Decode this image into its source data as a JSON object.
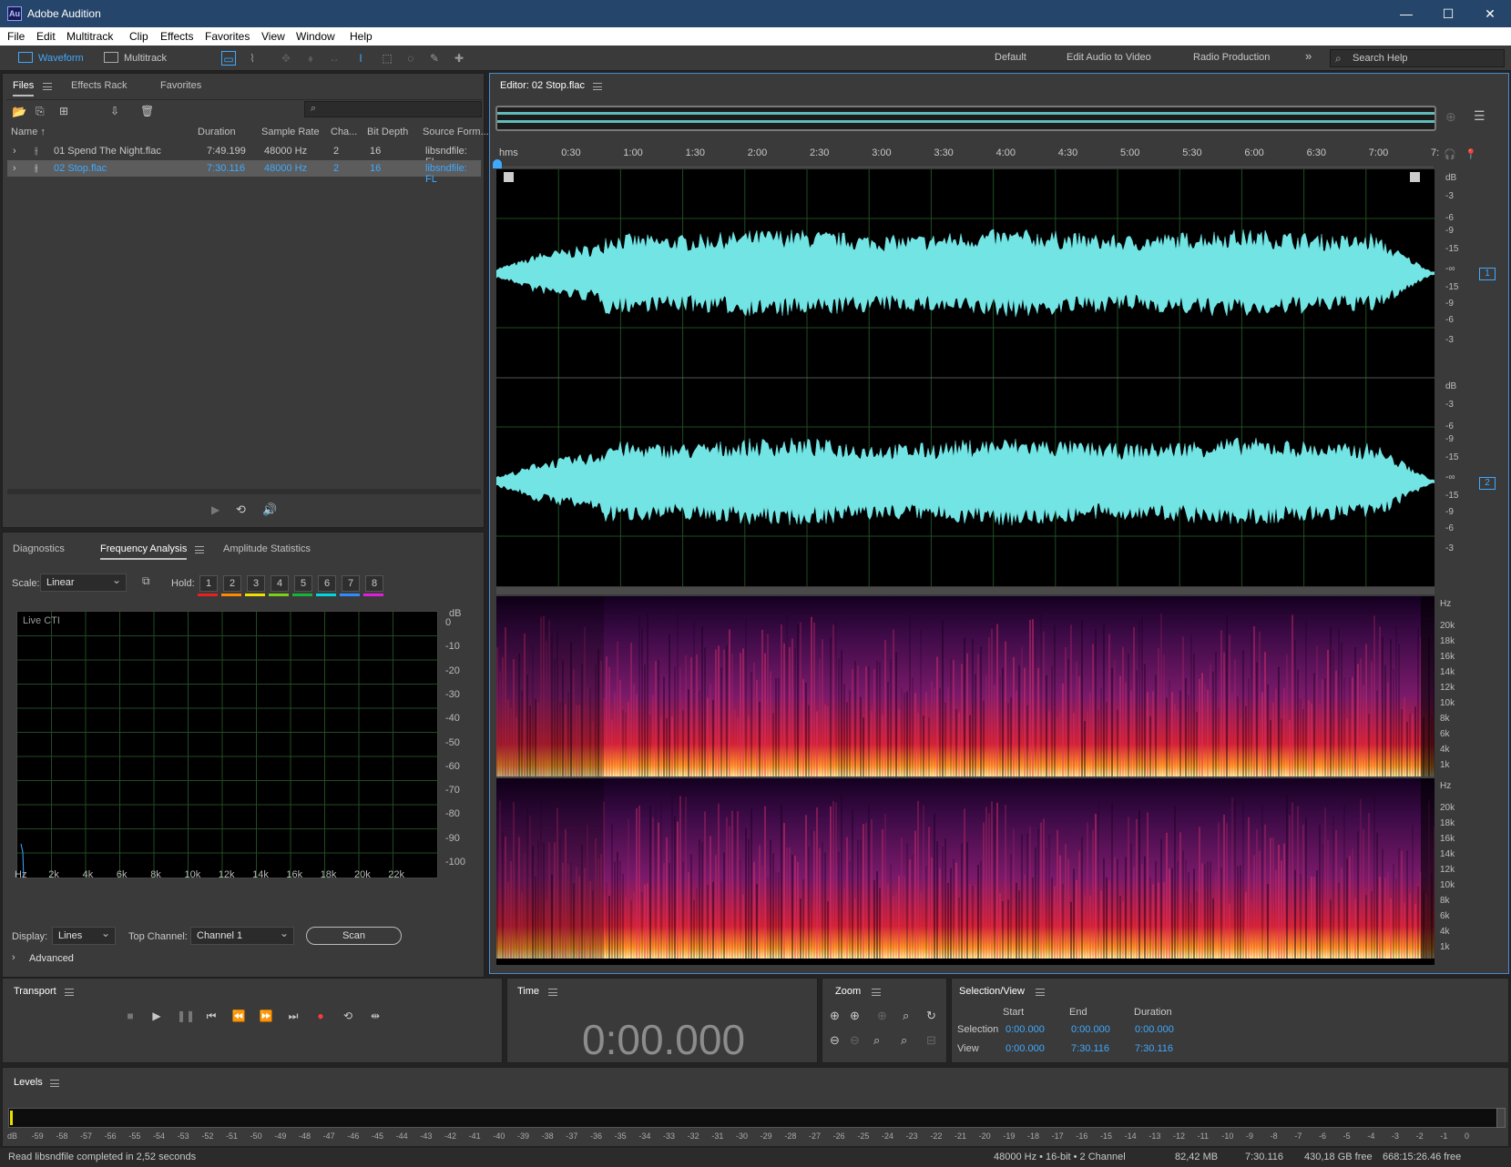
{
  "window": {
    "title": "Adobe Audition",
    "app_icon_text": "Au"
  },
  "menu": [
    "File",
    "Edit",
    "Multitrack",
    "Clip",
    "Effects",
    "Favorites",
    "View",
    "Window",
    "Help"
  ],
  "toolbar": {
    "waveform_label": "Waveform",
    "multitrack_label": "Multitrack",
    "workspaces": [
      "Default",
      "Edit Audio to Video",
      "Radio Production"
    ],
    "overflow": "»",
    "search_placeholder": "Search Help"
  },
  "files_panel": {
    "tabs": [
      "Files",
      "Effects Rack",
      "Favorites"
    ],
    "columns": [
      "Name",
      "Duration",
      "Sample Rate",
      "Cha...",
      "Bit Depth",
      "Source Form..."
    ],
    "sort_indicator": "↑",
    "rows": [
      {
        "name": "01 Spend The Night.flac",
        "duration": "7:49.199",
        "sample_rate": "48000 Hz",
        "channels": "2",
        "bit_depth": "16",
        "source_format": "libsndfile: FL"
      },
      {
        "name": "02 Stop.flac",
        "duration": "7:30.116",
        "sample_rate": "48000 Hz",
        "channels": "2",
        "bit_depth": "16",
        "source_format": "libsndfile: FL"
      }
    ]
  },
  "analysis_panel": {
    "tabs": [
      "Diagnostics",
      "Frequency Analysis",
      "Amplitude Statistics"
    ],
    "scale_label": "Scale:",
    "scale_value": "Linear",
    "hold_label": "Hold:",
    "hold_buttons": [
      "1",
      "2",
      "3",
      "4",
      "5",
      "6",
      "7",
      "8"
    ],
    "hold_colors": [
      "#e82020",
      "#ff8a00",
      "#f0e000",
      "#7ad11a",
      "#18b33a",
      "#00d6e0",
      "#2f8cff",
      "#e020d8"
    ],
    "live_cti": "Live CTI",
    "db_unit": "dB",
    "db_ticks": [
      "0",
      "-10",
      "-20",
      "-30",
      "-40",
      "-50",
      "-60",
      "-70",
      "-80",
      "-90",
      "-100"
    ],
    "hz_ticks": [
      "Hz",
      "2k",
      "4k",
      "6k",
      "8k",
      "10k",
      "12k",
      "14k",
      "16k",
      "18k",
      "20k",
      "22k"
    ],
    "display_label": "Display:",
    "display_value": "Lines",
    "top_channel_label": "Top Channel:",
    "top_channel_value": "Channel 1",
    "scan_label": "Scan",
    "advanced_label": "Advanced"
  },
  "editor": {
    "title": "Editor: 02 Stop.flac",
    "ruler": [
      "hms",
      "0:30",
      "1:00",
      "1:30",
      "2:00",
      "2:30",
      "3:00",
      "3:30",
      "4:00",
      "4:30",
      "5:00",
      "5:30",
      "6:00",
      "6:30",
      "7:00",
      "7:"
    ],
    "db_unit": "dB",
    "db_ticks": [
      "-3",
      "-6",
      "-9",
      "-15",
      "-∞",
      "-15",
      "-9",
      "-6",
      "-3"
    ],
    "channel_numbers": [
      "1",
      "2"
    ],
    "hz_unit": "Hz",
    "hz_ticks": [
      "20k",
      "18k",
      "16k",
      "14k",
      "12k",
      "10k",
      "8k",
      "6k",
      "4k",
      "1k"
    ],
    "waveform_color": "#72e4e4"
  },
  "transport": {
    "title": "Transport"
  },
  "time": {
    "title": "Time",
    "display": "0:00.000"
  },
  "zoom": {
    "title": "Zoom"
  },
  "selection_view": {
    "title": "Selection/View",
    "headers": [
      "Start",
      "End",
      "Duration"
    ],
    "rows": [
      {
        "label": "Selection",
        "start": "0:00.000",
        "end": "0:00.000",
        "duration": "0:00.000"
      },
      {
        "label": "View",
        "start": "0:00.000",
        "end": "7:30.116",
        "duration": "7:30.116"
      }
    ]
  },
  "levels": {
    "title": "Levels",
    "ticks": [
      "dB",
      "-59",
      "-58",
      "-57",
      "-56",
      "-55",
      "-54",
      "-53",
      "-52",
      "-51",
      "-50",
      "-49",
      "-48",
      "-47",
      "-46",
      "-45",
      "-44",
      "-43",
      "-42",
      "-41",
      "-40",
      "-39",
      "-38",
      "-37",
      "-36",
      "-35",
      "-34",
      "-33",
      "-32",
      "-31",
      "-30",
      "-29",
      "-28",
      "-27",
      "-26",
      "-25",
      "-24",
      "-23",
      "-22",
      "-21",
      "-20",
      "-19",
      "-18",
      "-17",
      "-16",
      "-15",
      "-14",
      "-13",
      "-12",
      "-11",
      "-10",
      "-9",
      "-8",
      "-7",
      "-6",
      "-5",
      "-4",
      "-3",
      "-2",
      "-1",
      "0"
    ]
  },
  "status": {
    "message": "Read libsndfile completed in 2,52 seconds",
    "format": "48000 Hz • 16-bit • 2 Channel",
    "size": "82,42 MB",
    "duration": "7:30.116",
    "free_space": "430,18 GB free",
    "free_time": "668:15:26.46 free"
  }
}
